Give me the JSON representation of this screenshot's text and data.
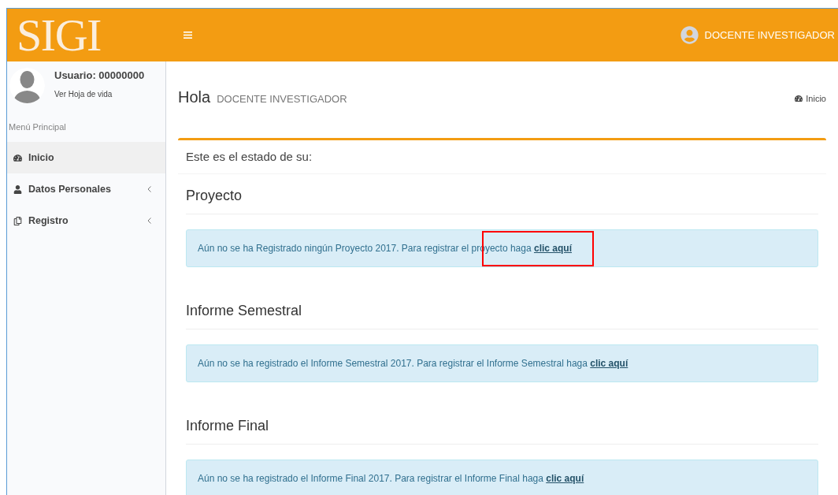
{
  "header": {
    "logo": "SIGI",
    "user_name": "DOCENTE INVESTIGADOR"
  },
  "sidebar": {
    "user_label": "Usuario: 00000000",
    "profile_link": "Ver Hoja de vida",
    "menu_title": "Menú Principal",
    "items": [
      {
        "label": "Inicio",
        "kind": "dashboard",
        "selected": true,
        "expandable": false
      },
      {
        "label": "Datos Personales",
        "kind": "user",
        "selected": false,
        "expandable": true
      },
      {
        "label": "Registro",
        "kind": "copy",
        "selected": false,
        "expandable": true
      }
    ]
  },
  "page": {
    "title": "Hola",
    "subtitle": "DOCENTE INVESTIGADOR",
    "breadcrumb": "Inicio"
  },
  "box": {
    "heading": "Este es el estado de su:",
    "sections": [
      {
        "title": "Proyecto",
        "message": "Aún no se ha Registrado ningún Proyecto 2017. Para registrar el proyecto haga",
        "link": "clic aquí",
        "highlighted": true
      },
      {
        "title": "Informe Semestral",
        "message": "Aún no se ha registrado el Informe Semestral 2017. Para registrar el Informe Semestral haga",
        "link": "clic aquí",
        "highlighted": false
      },
      {
        "title": "Informe Final",
        "message": "Aún no se ha registrado el Informe Final 2017. Para registrar el Informe Final haga",
        "link": "clic aquí",
        "highlighted": false
      }
    ]
  }
}
